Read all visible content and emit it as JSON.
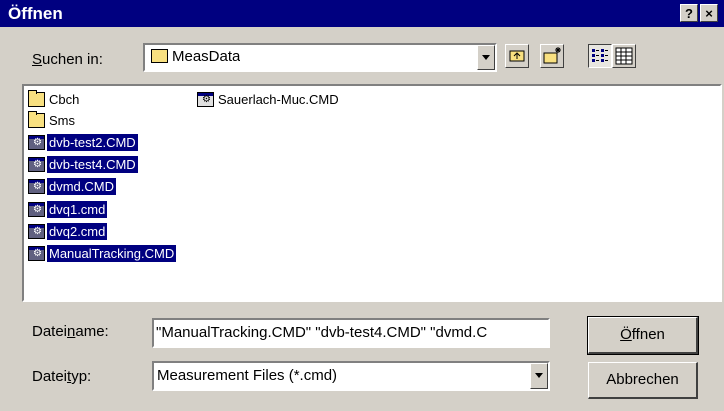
{
  "window": {
    "title": "Öffnen",
    "help_label": "?",
    "close_label": "×"
  },
  "lookin": {
    "label_pre": "",
    "label_acc": "S",
    "label_post": "uchen in:",
    "value": "MeasData",
    "value_icon": "folder-icon"
  },
  "toolbar": {
    "up_icon": "up-one-level-icon",
    "new_folder_icon": "new-folder-icon",
    "list_icon": "list-view-icon",
    "details_icon": "details-view-icon"
  },
  "files": [
    {
      "name": "Cbch",
      "type": "folder",
      "selected": false
    },
    {
      "name": "Sms",
      "type": "folder",
      "selected": false
    },
    {
      "name": "dvb-test2.CMD",
      "type": "file",
      "selected": true
    },
    {
      "name": "dvb-test4.CMD",
      "type": "file",
      "selected": true
    },
    {
      "name": "dvmd.CMD",
      "type": "file",
      "selected": true
    },
    {
      "name": "dvq1.cmd",
      "type": "file",
      "selected": true
    },
    {
      "name": "dvq2.cmd",
      "type": "file",
      "selected": true
    },
    {
      "name": "ManualTracking.CMD",
      "type": "file",
      "selected": true
    },
    {
      "name": "Sauerlach-Muc.CMD",
      "type": "file",
      "selected": false
    }
  ],
  "filename": {
    "label_pre": "Datei",
    "label_acc": "n",
    "label_post": "ame:",
    "value": "\"ManualTracking.CMD\" \"dvb-test4.CMD\" \"dvmd.C"
  },
  "filetype": {
    "label_pre": "Datei",
    "label_acc": "t",
    "label_post": "yp:",
    "value": "Measurement Files (*.cmd)"
  },
  "buttons": {
    "open_acc": "Ö",
    "open_rest": "ffnen",
    "cancel": "Abbrechen"
  }
}
